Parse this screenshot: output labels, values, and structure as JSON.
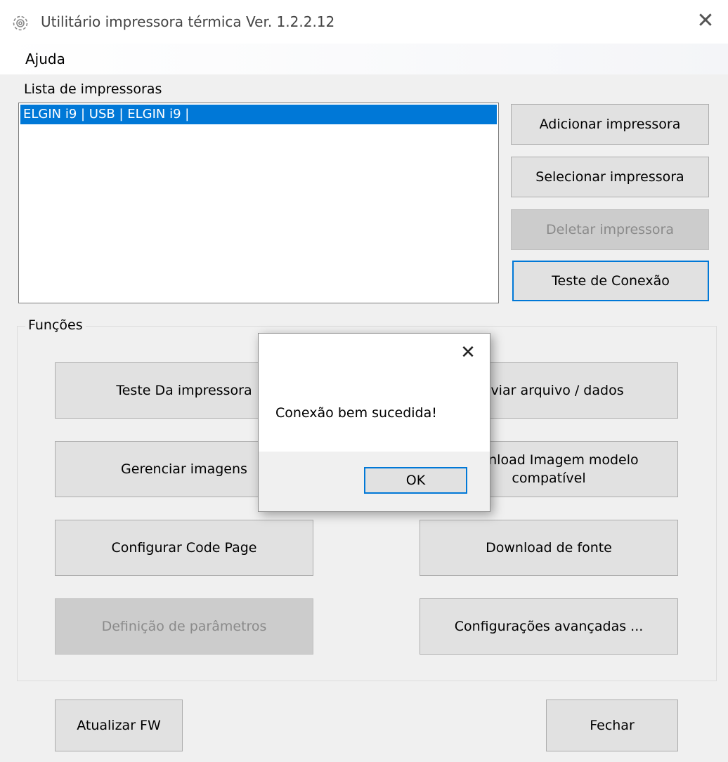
{
  "window": {
    "title": "Utilitário impressora térmica Ver. 1.2.2.12",
    "icon": "gear-icon",
    "close_glyph": "✕"
  },
  "menu": {
    "items": [
      "Ajuda"
    ]
  },
  "printer_list": {
    "label": "Lista de impressoras",
    "items": [
      "ELGIN i9 | USB | ELGIN i9 |"
    ],
    "selected_index": 0
  },
  "printer_buttons": {
    "add": "Adicionar impressora",
    "select": "Selecionar impressora",
    "delete": "Deletar impressora",
    "test_connection": "Teste de Conexão"
  },
  "functions": {
    "title": "Funções",
    "printer_test": "Teste Da impressora",
    "send_file": "Enviar arquivo / dados",
    "manage_images": "Gerenciar imagens",
    "download_image_line1": "Download Imagem modelo",
    "download_image_line2": "compatível",
    "code_page": "Configurar Code Page",
    "download_font": "Download de fonte",
    "parameters": "Definição de parâmetros",
    "advanced": "Configurações avançadas ..."
  },
  "footer": {
    "update_fw": "Atualizar FW",
    "close": "Fechar"
  },
  "dialog": {
    "message": "Conexão bem sucedida!",
    "ok": "OK",
    "close_glyph": "✕"
  },
  "colors": {
    "selection": "#0078d7",
    "focus_border": "#0078d7",
    "button_face": "#e1e1e1",
    "disabled_face": "#cccccc"
  }
}
